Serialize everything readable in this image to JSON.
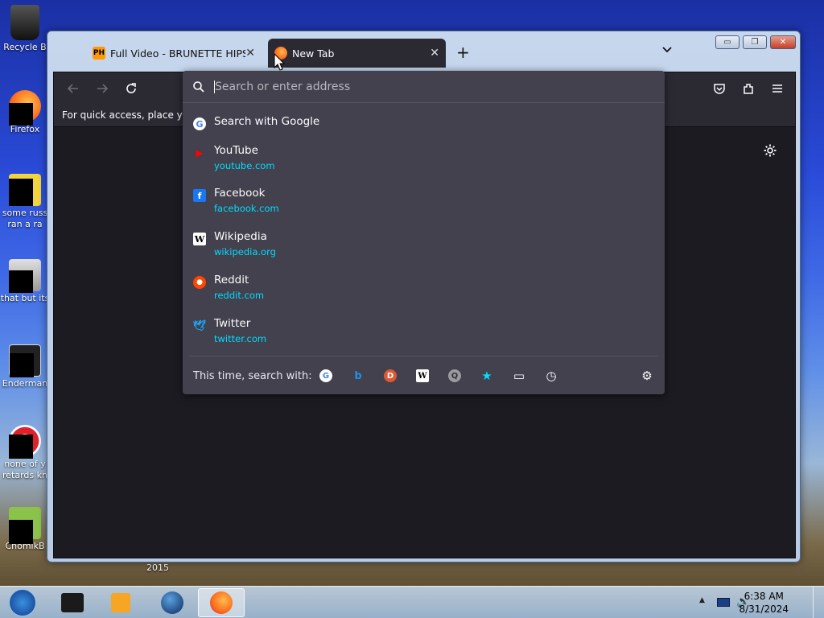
{
  "desktop": {
    "icons": [
      {
        "label": "Recycle B",
        "icon": "recycle-bin-icon"
      },
      {
        "label": "Firefox",
        "icon": "firefox-icon"
      },
      {
        "label": "some russ\nran a ra",
        "icon": "document-icon"
      },
      {
        "label": "that but its",
        "icon": "folder-icon"
      },
      {
        "label": "Enderman",
        "icon": "file-icon"
      },
      {
        "label": "none of y\nretards kn",
        "icon": "opera-icon"
      },
      {
        "label": "ChomikB",
        "icon": "app-icon"
      }
    ],
    "stray_label": "2015"
  },
  "window": {
    "tabs": [
      {
        "label": "Full Video - BRUNETTE HIPSTER",
        "favicon": "PH",
        "active": false
      },
      {
        "label": "New Tab",
        "favicon": "firefox",
        "active": true
      }
    ],
    "new_tab_symbol": "+",
    "list_all_tabs_symbol": "⌄"
  },
  "bookmarks_bar": {
    "text": "For quick access, place your b"
  },
  "urlbar": {
    "placeholder": "Search or enter address",
    "search_with_google": "Search with Google",
    "suggestions": [
      {
        "title": "YouTube",
        "url": "youtube.com",
        "icon": "youtube-icon",
        "color": "#ff0000"
      },
      {
        "title": "Facebook",
        "url": "facebook.com",
        "icon": "facebook-icon",
        "color": "#1877f2"
      },
      {
        "title": "Wikipedia",
        "url": "wikipedia.org",
        "icon": "wikipedia-icon",
        "color": "#ffffff"
      },
      {
        "title": "Reddit",
        "url": "reddit.com",
        "icon": "reddit-icon",
        "color": "#ff4500"
      },
      {
        "title": "Twitter",
        "url": "twitter.com",
        "icon": "twitter-icon",
        "color": "#1da1f2"
      }
    ],
    "one_offs_label": "This time, search with:",
    "one_offs": [
      {
        "name": "google-engine-icon",
        "glyph": "G",
        "color": "#4285f4"
      },
      {
        "name": "bing-engine-icon",
        "glyph": "b",
        "color": "#1b93e8"
      },
      {
        "name": "duckduckgo-engine-icon",
        "glyph": "D",
        "color": "#de5833"
      },
      {
        "name": "wikipedia-engine-icon",
        "glyph": "W",
        "color": "#ffffff"
      },
      {
        "name": "search-engine-icon",
        "glyph": "Q",
        "color": "#9a9aa0"
      },
      {
        "name": "bookmarks-icon",
        "glyph": "★",
        "color": "#00ddff"
      },
      {
        "name": "tabs-icon",
        "glyph": "▭",
        "color": "#fbfbfe"
      },
      {
        "name": "history-icon",
        "glyph": "◷",
        "color": "#fbfbfe"
      }
    ]
  },
  "taskbar": {
    "time": "6:38 AM",
    "date": "8/31/2024"
  }
}
